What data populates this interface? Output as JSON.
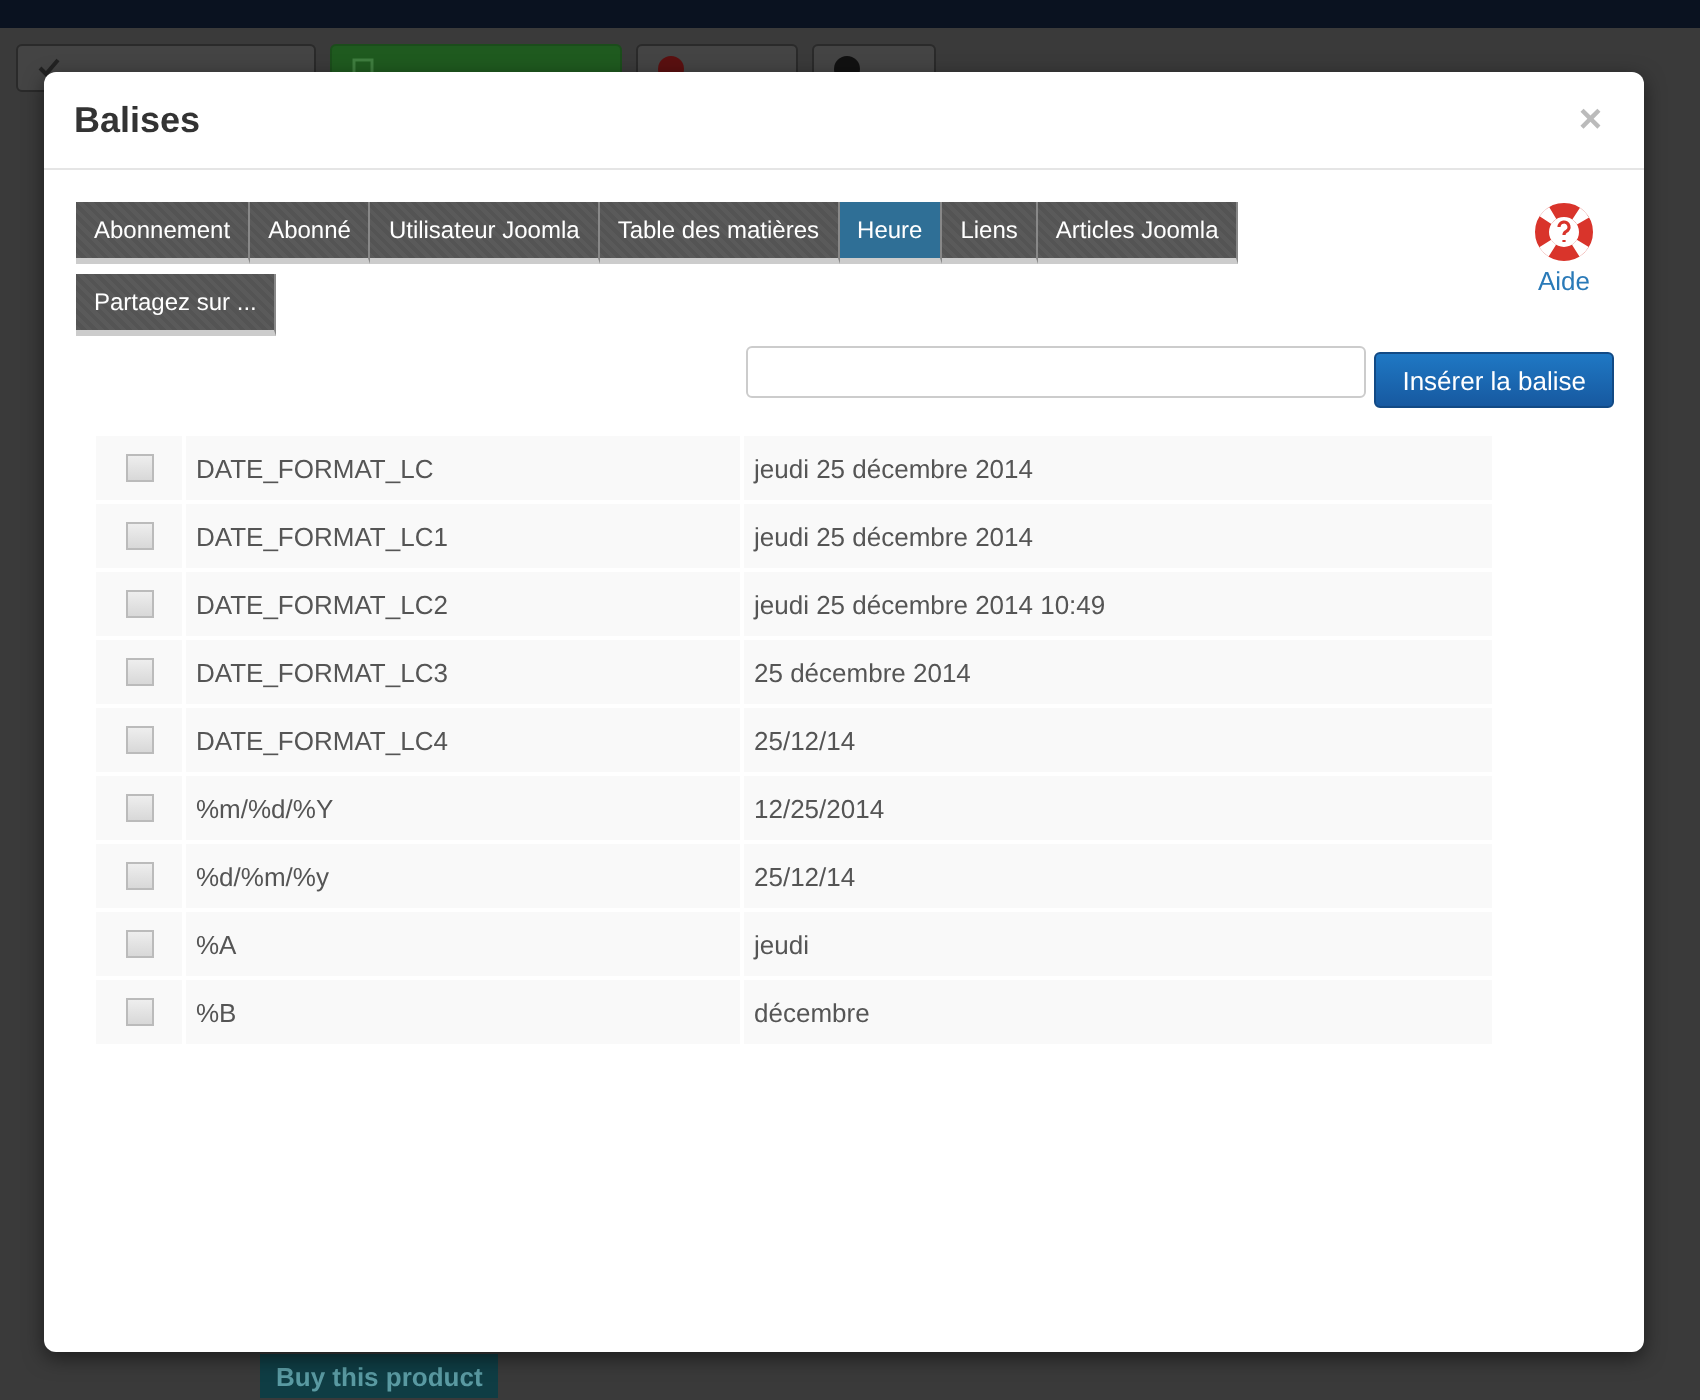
{
  "background": {
    "toolbar": [
      {
        "kind": "check"
      },
      {
        "kind": "save"
      },
      {
        "kind": "cancel"
      },
      {
        "kind": "help"
      }
    ],
    "buy_button": "Buy this product"
  },
  "modal": {
    "title": "Balises",
    "close": "×",
    "tabs": [
      {
        "label": "Abonnement",
        "selected": false
      },
      {
        "label": "Abonné",
        "selected": false
      },
      {
        "label": "Utilisateur Joomla",
        "selected": false
      },
      {
        "label": "Table des matières",
        "selected": false
      },
      {
        "label": "Heure",
        "selected": true
      },
      {
        "label": "Liens",
        "selected": false
      },
      {
        "label": "Articles Joomla",
        "selected": false
      },
      {
        "label": "Partagez sur ...",
        "selected": false
      }
    ],
    "help": "Aide",
    "insert_button": "Insérer la balise",
    "rows": [
      {
        "tag": "DATE_FORMAT_LC",
        "value": "jeudi 25 décembre 2014",
        "checked": false
      },
      {
        "tag": "DATE_FORMAT_LC1",
        "value": "jeudi 25 décembre 2014",
        "checked": false
      },
      {
        "tag": "DATE_FORMAT_LC2",
        "value": "jeudi 25 décembre 2014 10:49",
        "checked": false
      },
      {
        "tag": "DATE_FORMAT_LC3",
        "value": "25 décembre 2014",
        "checked": false
      },
      {
        "tag": "DATE_FORMAT_LC4",
        "value": "25/12/14",
        "checked": false
      },
      {
        "tag": "%m/%d/%Y",
        "value": "12/25/2014",
        "checked": false
      },
      {
        "tag": "%d/%m/%y",
        "value": "25/12/14",
        "checked": false
      },
      {
        "tag": "%A",
        "value": "jeudi",
        "checked": false
      },
      {
        "tag": "%B",
        "value": "décembre",
        "checked": false
      }
    ]
  }
}
